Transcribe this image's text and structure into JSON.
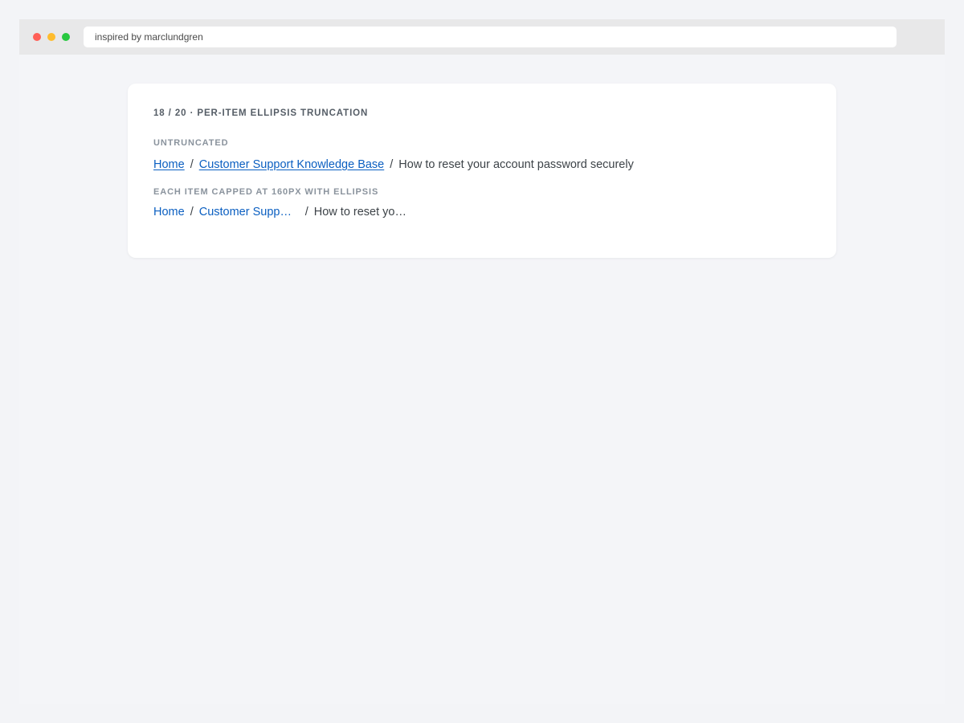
{
  "browser": {
    "url": "inspired by marclundgren"
  },
  "card": {
    "title": "18 / 20 · PER-ITEM ELLIPSIS TRUNCATION",
    "sections": [
      {
        "label": "UNTRUNCATED",
        "items": [
          "Home",
          "Customer Support Knowledge Base",
          "How to reset your account password securely"
        ]
      },
      {
        "label": "EACH ITEM CAPPED AT 160PX WITH ELLIPSIS",
        "items": [
          "Home",
          "Customer Support Knowledge Base",
          "How to reset your account password securely"
        ]
      }
    ],
    "separator": "/"
  },
  "colors": {
    "link": "#0b5fc1",
    "text": "#3d4348",
    "label": "#8a939d"
  }
}
